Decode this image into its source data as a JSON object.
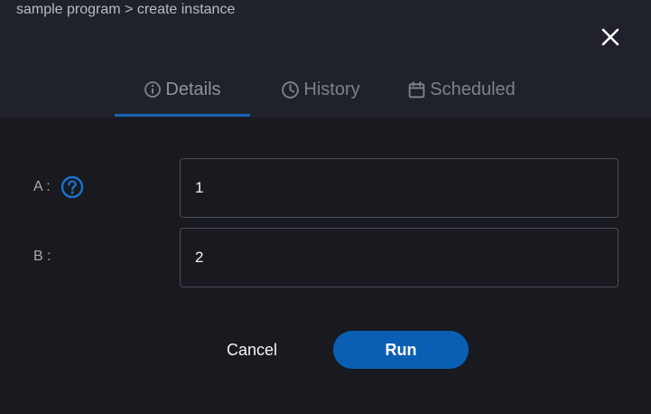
{
  "breadcrumb": {
    "text": "sample program > create instance"
  },
  "tabs": [
    {
      "label": "Details",
      "icon": "info-icon",
      "active": true
    },
    {
      "label": "History",
      "icon": "clock-icon",
      "active": false
    },
    {
      "label": "Scheduled",
      "icon": "calendar-icon",
      "active": false
    }
  ],
  "fields": [
    {
      "label": "A :",
      "value": "1",
      "has_help": true,
      "help_icon": "help-circle-icon"
    },
    {
      "label": "B :",
      "value": "2",
      "has_help": false
    }
  ],
  "actions": {
    "cancel_label": "Cancel",
    "run_label": "Run"
  },
  "colors": {
    "accent": "#1a63b5",
    "run_button": "#0a5fb4",
    "header_bg": "#1f222a",
    "body_bg": "#181a20"
  }
}
